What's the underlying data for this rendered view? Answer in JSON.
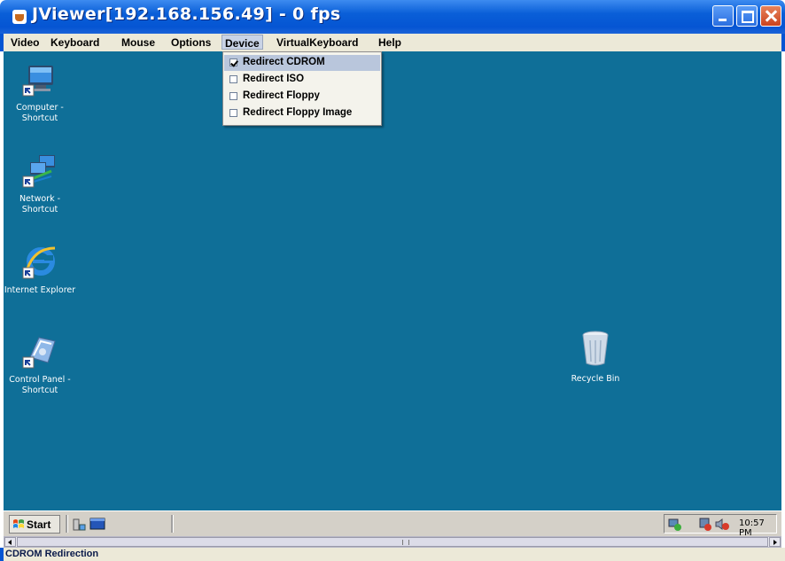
{
  "window": {
    "title": "JViewer[192.168.156.49] - 0 fps"
  },
  "menubar": {
    "items": [
      "Video",
      "Keyboard",
      "Mouse",
      "Options",
      "Device",
      "VirtualKeyboard",
      "Help"
    ],
    "active": "Device"
  },
  "device_menu": {
    "items": [
      {
        "label": "Redirect CDROM",
        "checked": true,
        "highlighted": true
      },
      {
        "label": "Redirect ISO",
        "checked": false,
        "highlighted": false
      },
      {
        "label": "Redirect Floppy",
        "checked": false,
        "highlighted": false
      },
      {
        "label": "Redirect Floppy Image",
        "checked": false,
        "highlighted": false
      }
    ]
  },
  "desktop": {
    "background_color": "#0f6f98",
    "icons": [
      {
        "label": "Computer - Shortcut",
        "icon": "computer-icon",
        "shortcut": true
      },
      {
        "label": "Network - Shortcut",
        "icon": "network-icon",
        "shortcut": true
      },
      {
        "label": "Internet Explorer",
        "icon": "internet-explorer-icon",
        "shortcut": true
      },
      {
        "label": "Control Panel - Shortcut",
        "icon": "control-panel-icon",
        "shortcut": true
      },
      {
        "label": "Recycle Bin",
        "icon": "recycle-bin-icon",
        "shortcut": false
      }
    ]
  },
  "taskbar": {
    "start_label": "Start",
    "clock": "10:57 PM"
  },
  "statusbar": {
    "text": "CDROM Redirection"
  },
  "colors": {
    "titlebar": "#0555d3",
    "menu_highlight": "#b9c6dc",
    "desktop": "#0f6f98"
  }
}
